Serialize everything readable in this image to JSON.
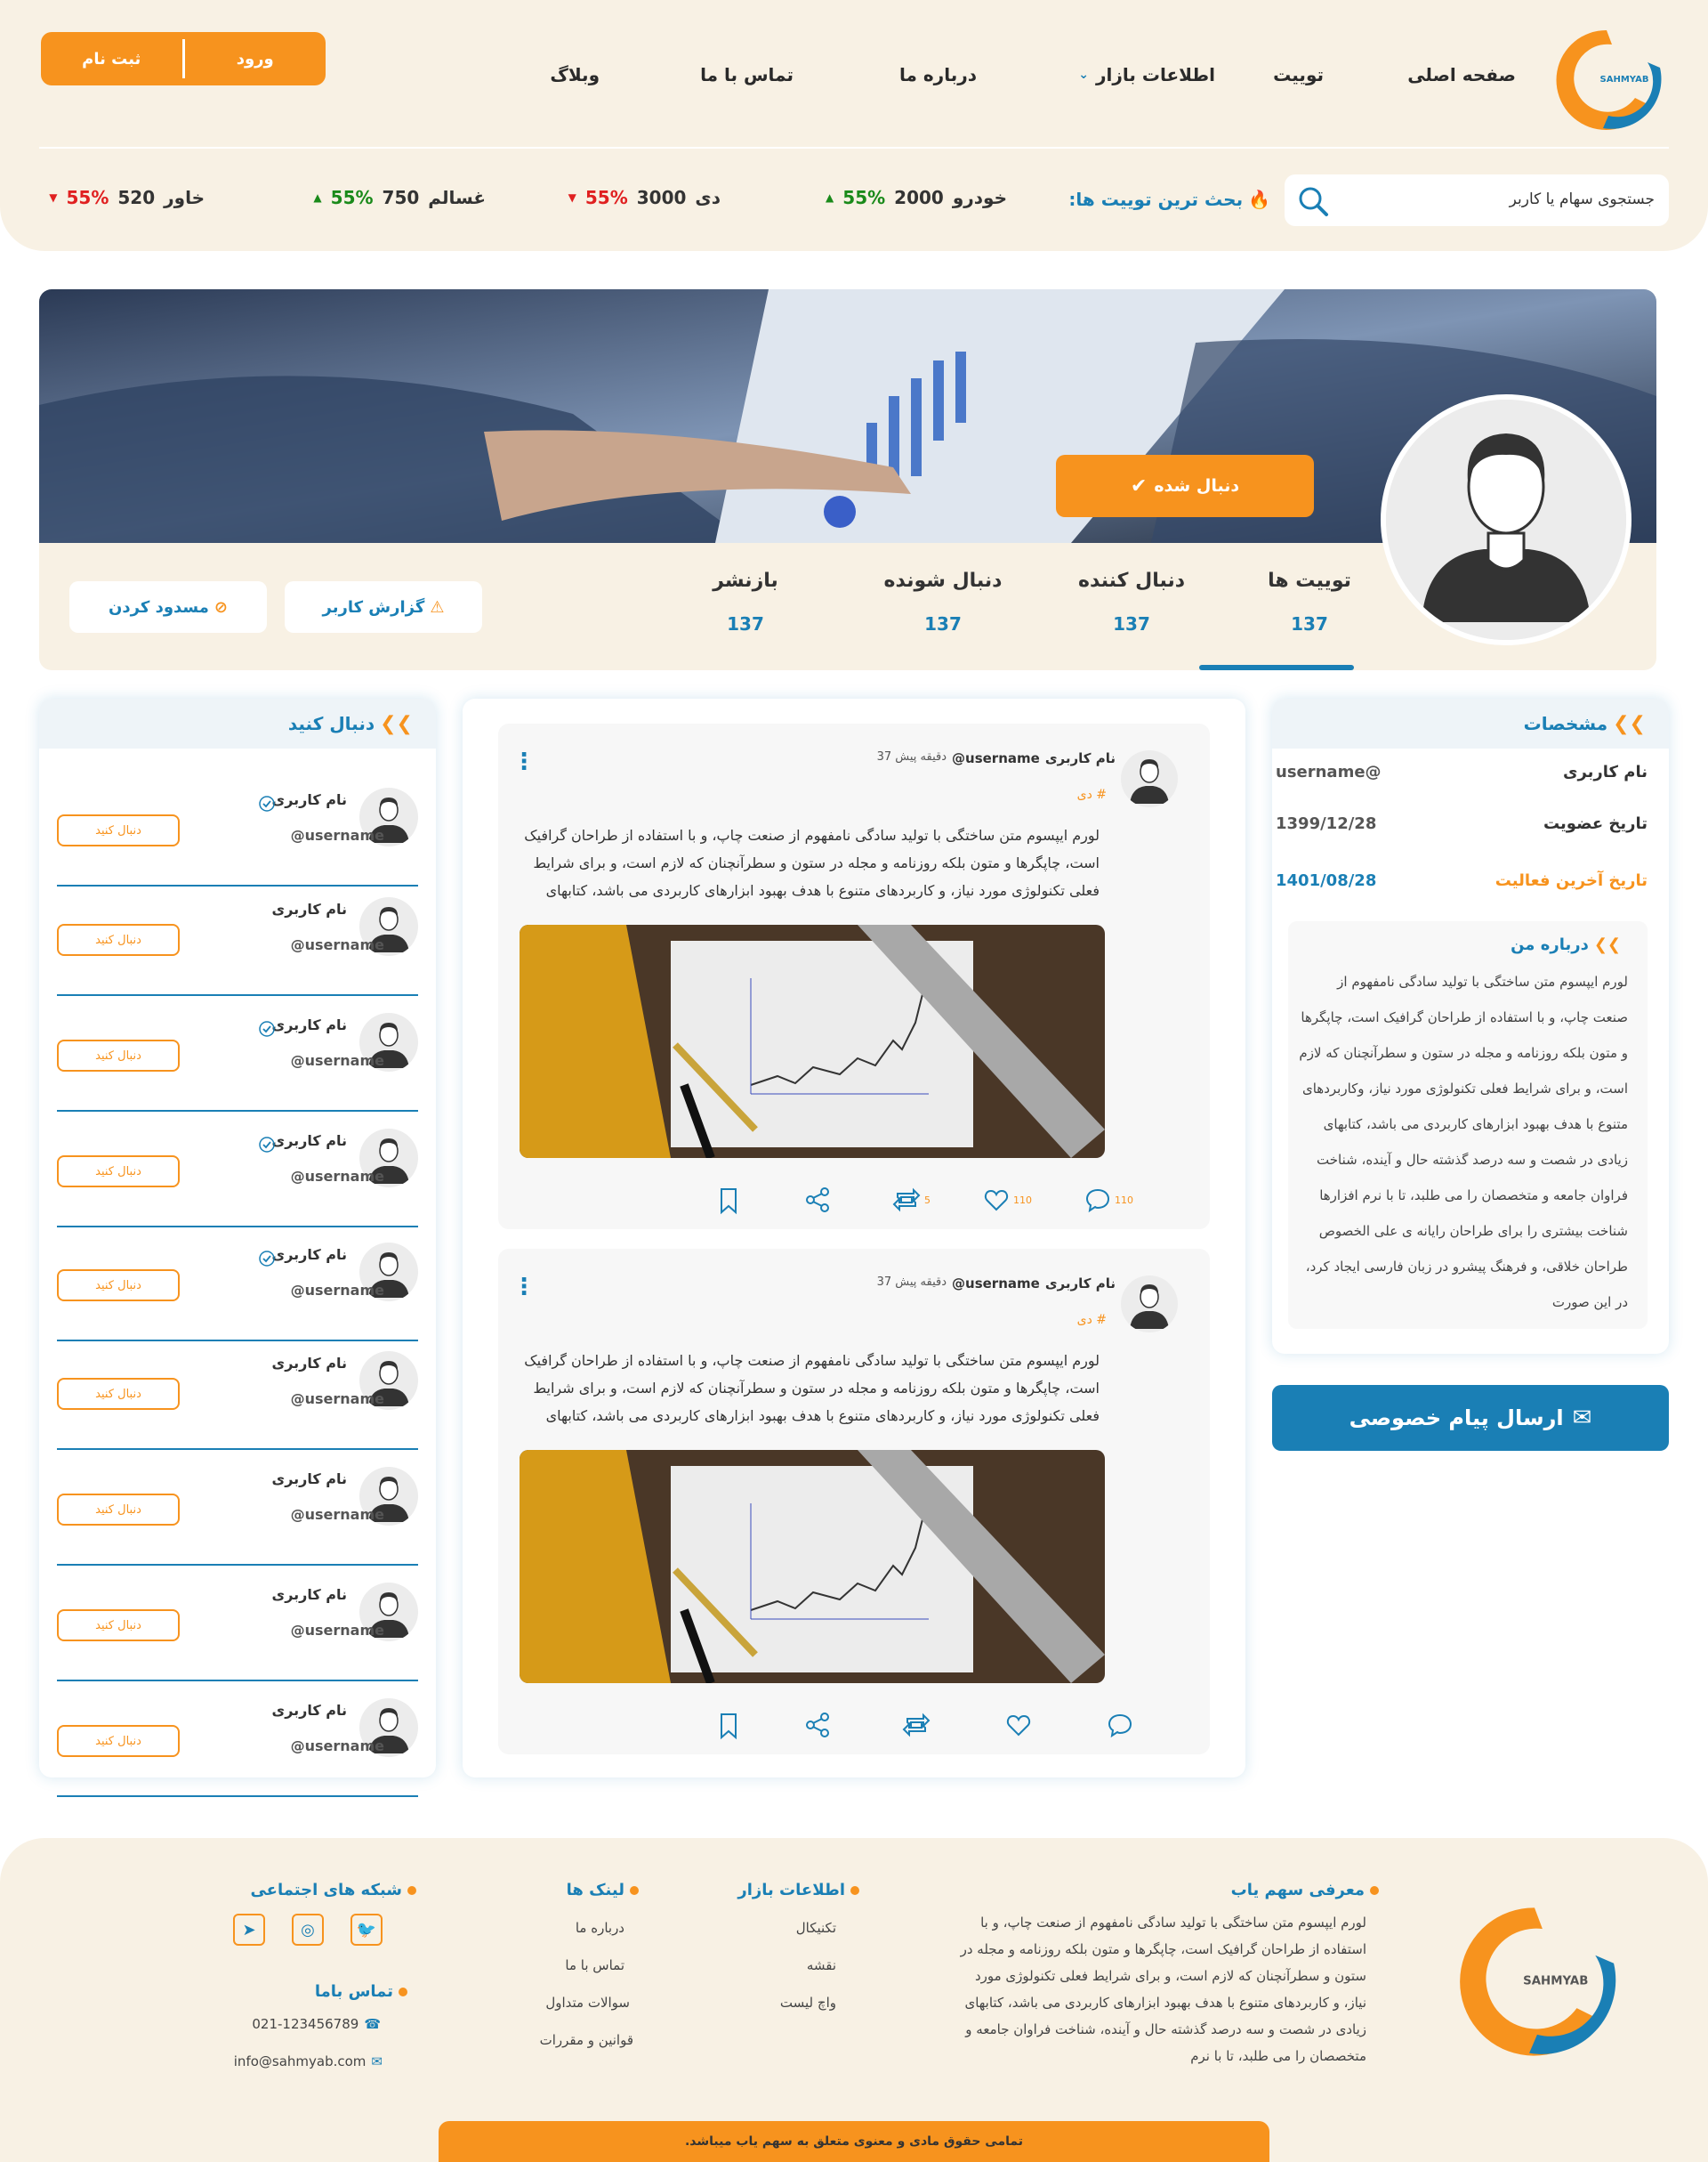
{
  "header": {
    "brand": "SAHMYAB",
    "nav": [
      "صفحه اصلی",
      "توییت",
      "اطلاعات بازار",
      "درباره ما",
      "تماس با ما",
      "وبلاگ"
    ],
    "auth": {
      "login": "ورود",
      "register": "ثبت نام"
    },
    "search_placeholder": "جستجوی سهام  یا کاربر",
    "hot_label": "بحث ترین توییت ها:",
    "tickers": [
      {
        "name": "خودرو",
        "value": "2000",
        "change": "55%",
        "dir": "up"
      },
      {
        "name": "دی",
        "value": "3000",
        "change": "55%",
        "dir": "down"
      },
      {
        "name": "غسالم",
        "value": "750",
        "change": "55%",
        "dir": "up"
      },
      {
        "name": "خاور",
        "value": "520",
        "change": "55%",
        "dir": "down"
      }
    ]
  },
  "profile": {
    "follow_label": "دنبال شده",
    "stats": [
      {
        "label": "توییت ها",
        "value": "137"
      },
      {
        "label": "دنبال کننده",
        "value": "137"
      },
      {
        "label": "دنبال شونده",
        "value": "137"
      },
      {
        "label": "بازنشر",
        "value": "137"
      }
    ],
    "report_label": "گزارش کاربر",
    "block_label": "مسدود کردن"
  },
  "info": {
    "title": "مشخصات",
    "rows": [
      {
        "label": "نام کاربری",
        "value": "@username"
      },
      {
        "label": "تاریخ عضویت",
        "value": "1399/12/28"
      },
      {
        "label": "تاریخ آخرین فعالیت",
        "value": "1401/08/28"
      }
    ],
    "about_title": "درباره من",
    "about_text": "لورم ایپسوم متن ساختگی با تولید سادگی نامفهوم از صنعت چاپ، و با استفاده از طراحان گرافیک است، چاپگرها و متون بلکه روزنامه و مجله در ستون و سطرآنچنان که لازم است، و برای شرایط فعلی تکنولوژی مورد نیاز، وکاربردهای متنوع با هدف بهبود ابزارهای کاربردی می باشد، کتابهای زیادی در شصت و سه درصد گذشته حال و آینده، شناخت فراوان جامعه و متخصصان را می طلبد، تا با نرم افزارها شناخت بیشتری را برای طراحان رایانه ی علی الخصوص طراحان خلاقی، و فرهنگ پیشرو در زبان فارسی ایجاد کرد، در این صورت",
    "message_button": "ارسال پیام خصوصی"
  },
  "posts": [
    {
      "user": "نام کاربری",
      "handle": "@username",
      "time": "37 دقیقه پیش",
      "tag": "# دی",
      "text": "لورم ایپسوم متن ساختگی با تولید سادگی نامفهوم از صنعت چاپ، و با استفاده از طراحان گرافیک است، چاپگرها و متون بلکه روزنامه و مجله در ستون و سطرآنچنان که لازم است، و برای شرایط فعلی تکنولوژی مورد نیاز، و کاربردهای متنوع با هدف بهبود ابزارهای کاربردی می باشد، کتابهای",
      "comments": "110",
      "likes": "110",
      "retweets": "5"
    },
    {
      "user": "نام کاربری",
      "handle": "@username",
      "time": "37 دقیقه پیش",
      "tag": "# دی",
      "text": "لورم ایپسوم متن ساختگی با تولید سادگی نامفهوم از صنعت چاپ، و با استفاده از طراحان گرافیک است، چاپگرها و متون بلکه روزنامه و مجله در ستون و سطرآنچنان که لازم است، و برای شرایط فعلی تکنولوژی مورد نیاز، و کاربردهای متنوع با هدف بهبود ابزارهای کاربردی می باشد، کتابهای",
      "comments": "",
      "likes": "",
      "retweets": ""
    }
  ],
  "suggest": {
    "title": "دنبال کنید",
    "follow_button": "دنبال کنید",
    "users": [
      {
        "name": "نام کاربری",
        "handle": "@username",
        "verified": true
      },
      {
        "name": "نام کاربری",
        "handle": "@username",
        "verified": false
      },
      {
        "name": "نام کاربری",
        "handle": "@username",
        "verified": true
      },
      {
        "name": "نام کاربری",
        "handle": "@username",
        "verified": true
      },
      {
        "name": "نام کاربری",
        "handle": "@username",
        "verified": true
      },
      {
        "name": "نام کاربری",
        "handle": "@username",
        "verified": false
      },
      {
        "name": "نام کاربری",
        "handle": "@username",
        "verified": false
      },
      {
        "name": "نام کاربری",
        "handle": "@username",
        "verified": false
      },
      {
        "name": "نام کاربری",
        "handle": "@username",
        "verified": false
      }
    ]
  },
  "footer": {
    "about_title": "معرفی سهم یاب",
    "about_text": "لورم ایپسوم متن ساختگی با تولید سادگی نامفهوم از صنعت چاپ، و با استفاده از طراحان گرافیک است، چاپگرها و متون بلکه روزنامه و مجله در ستون و سطرآنچنان که لازم است، و برای شرایط فعلی تکنولوژی مورد نیاز، و کاربردهای متنوع با هدف بهبود ابزارهای کاربردی می باشد، کتابهای زیادی در شصت و سه درصد گذشته حال و آینده، شناخت فراوان جامعه و متخصصان را می طلبد، تا با نرم",
    "market_title": "اطلاعات بازار",
    "market_links": [
      "تکنیکال",
      "نقشه",
      "واچ لیست"
    ],
    "links_title": "لینک ها",
    "links": [
      "درباره ما",
      "تماس با ما",
      "سوالات متداول",
      "قوانین و مقررات"
    ],
    "social_title": "شبکه های اجتماعی",
    "contact_title": "تماس باما",
    "phone": "021-123456789",
    "email": "info@sahmyab.com",
    "copyright": "تمامی حقوق مادی و معنوی  متعلق به سهم یاب میباشد."
  }
}
